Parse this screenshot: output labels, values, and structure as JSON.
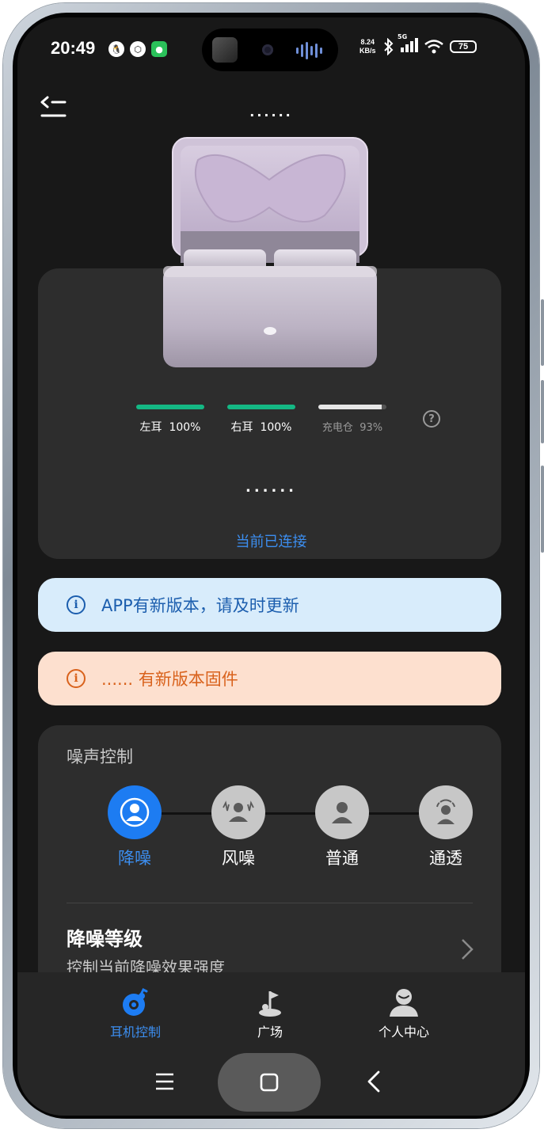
{
  "status_bar": {
    "time": "20:49",
    "notifications": [
      "qq-icon",
      "app-cube-icon",
      "wechat-icon"
    ],
    "net_speed_value": "8.24",
    "net_speed_unit": "KB/s",
    "network_type": "5G",
    "battery_level": "75"
  },
  "header": {
    "device_name": "......"
  },
  "device_card": {
    "left_ear_label": "左耳",
    "left_ear_value": "100%",
    "left_ear_fraction": 1.0,
    "right_ear_label": "右耳",
    "right_ear_value": "100%",
    "right_ear_fraction": 1.0,
    "case_label": "充电仓",
    "case_value": "93%",
    "case_fraction": 0.93,
    "help_symbol": "?",
    "device_name": "......",
    "status": "当前已连接",
    "colors": {
      "ear_bar": "#14b884",
      "case_bar": "#e6e6e6",
      "connected": "#3c8ef0"
    }
  },
  "banners": {
    "app_update": {
      "icon_symbol": "i",
      "text": "APP有新版本，请及时更新"
    },
    "firmware_update": {
      "icon_symbol": "i",
      "text": "...... 有新版本固件"
    }
  },
  "noise_control": {
    "title": "噪声控制",
    "modes": [
      {
        "label": "降噪",
        "icon": "anc-person-icon",
        "active": true
      },
      {
        "label": "风噪",
        "icon": "wind-noise-person-icon",
        "active": false
      },
      {
        "label": "普通",
        "icon": "normal-person-icon",
        "active": false
      },
      {
        "label": "通透",
        "icon": "transparency-person-icon",
        "active": false
      }
    ],
    "level_title": "降噪等级",
    "level_subtitle": "控制当前降噪效果强度"
  },
  "bottom_nav": {
    "items": [
      {
        "label": "耳机控制",
        "icon": "earphone-control-icon",
        "active": true
      },
      {
        "label": "广场",
        "icon": "plaza-flag-icon",
        "active": false
      },
      {
        "label": "个人中心",
        "icon": "profile-icon",
        "active": false
      }
    ]
  },
  "system_nav": {
    "menu": "menu-icon",
    "home": "home-icon",
    "back": "back-icon"
  }
}
